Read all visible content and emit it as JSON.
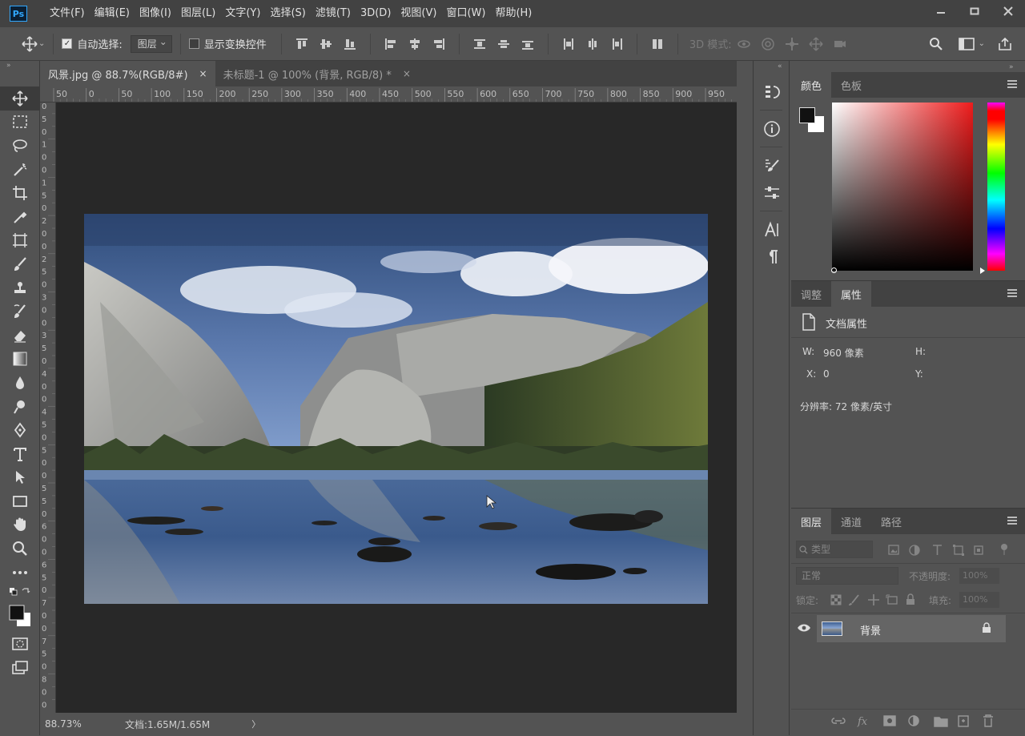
{
  "app": {
    "logo": "Ps"
  },
  "menu": [
    "文件(F)",
    "编辑(E)",
    "图像(I)",
    "图层(L)",
    "文字(Y)",
    "选择(S)",
    "滤镜(T)",
    "3D(D)",
    "视图(V)",
    "窗口(W)",
    "帮助(H)"
  ],
  "options": {
    "auto_select_label": "自动选择:",
    "auto_select_target": "图层",
    "show_transform_label": "显示变换控件",
    "mode_3d_label": "3D 模式:"
  },
  "tabs": [
    {
      "label": "风景.jpg @ 88.7%(RGB/8#)",
      "close": "×"
    },
    {
      "label": "未标题-1 @ 100% (背景, RGB/8) *",
      "close": "×"
    }
  ],
  "ruler_top": [
    "50",
    "0",
    "50",
    "100",
    "150",
    "200",
    "250",
    "300",
    "350",
    "400",
    "450",
    "500",
    "550",
    "600",
    "650",
    "700",
    "750",
    "800",
    "850",
    "900",
    "950"
  ],
  "ruler_left": [
    "0",
    "5",
    "0",
    "1",
    "0",
    "0",
    "1",
    "5",
    "0",
    "2",
    "0",
    "0",
    "2",
    "5",
    "0",
    "3",
    "0",
    "0",
    "3",
    "5",
    "0",
    "4",
    "0",
    "0",
    "4",
    "5",
    "0",
    "5",
    "0",
    "0",
    "5",
    "5",
    "0",
    "6",
    "0",
    "0",
    "6",
    "5",
    "0",
    "7",
    "0",
    "0",
    "7",
    "5",
    "0",
    "8",
    "0",
    "0"
  ],
  "status": {
    "zoom": "88.73%",
    "doc": "文档:1.65M/1.65M",
    "arrow": "〉"
  },
  "color_panel": {
    "tabs": [
      "颜色",
      "色板"
    ],
    "fg": "#111111",
    "bg": "#ffffff",
    "hue": "#ee1c1c"
  },
  "properties_panel": {
    "tabs": [
      "调整",
      "属性"
    ],
    "section": "文档属性",
    "w_label": "W:",
    "w_value": "960 像素",
    "h_label": "H:",
    "x_label": "X:",
    "x_value": "0",
    "y_label": "Y:",
    "resolution": "分辨率: 72 像素/英寸"
  },
  "layers_panel": {
    "tabs": [
      "图层",
      "通道",
      "路径"
    ],
    "filter_kind": "类型",
    "blend_mode": "正常",
    "opacity_label": "不透明度:",
    "opacity_value": "100%",
    "lock_label": "锁定:",
    "fill_label": "填充:",
    "fill_value": "100%",
    "layer": {
      "name": "背景"
    }
  },
  "colors": {
    "accent": "#31a8ff",
    "panel": "#535353",
    "dark": "#424242",
    "canvas": "#282828"
  }
}
